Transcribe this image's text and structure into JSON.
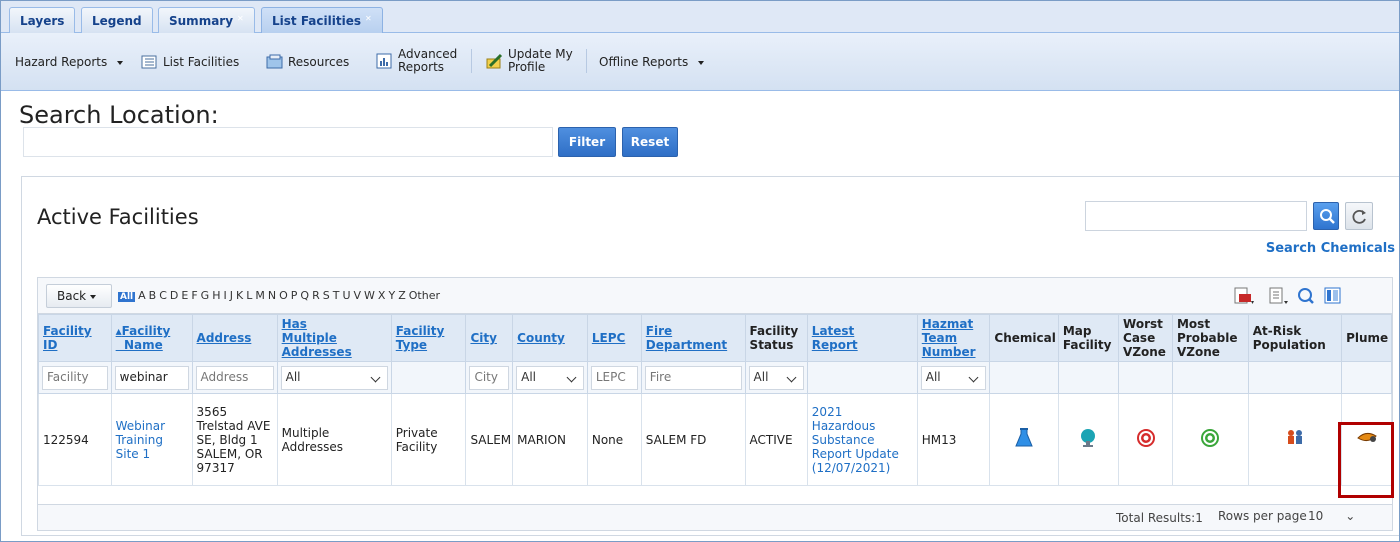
{
  "tabs": [
    {
      "label": "Layers",
      "closable": false
    },
    {
      "label": "Legend",
      "closable": false
    },
    {
      "label": "Summary",
      "closable": true
    },
    {
      "label": "List Facilities",
      "closable": true,
      "active": true
    }
  ],
  "toolbar": {
    "hazard_reports": "Hazard Reports",
    "list_facilities": "List Facilities",
    "resources": "Resources",
    "advanced_line1": "Advanced",
    "advanced_line2": "Reports",
    "update_line1": "Update My",
    "update_line2": "Profile",
    "offline_reports": "Offline Reports"
  },
  "search": {
    "title": "Search Location:",
    "value": "",
    "filter_label": "Filter",
    "reset_label": "Reset"
  },
  "active": {
    "title": "Active Facilities",
    "chem_value": "",
    "search_chemicals": "Search Chemicals"
  },
  "grid": {
    "back_label": "Back",
    "all_label": "All",
    "letters": [
      "A",
      "B",
      "C",
      "D",
      "E",
      "F",
      "G",
      "H",
      "I",
      "J",
      "K",
      "L",
      "M",
      "N",
      "O",
      "P",
      "Q",
      "R",
      "S",
      "T",
      "U",
      "V",
      "W",
      "X",
      "Y",
      "Z",
      "Other"
    ],
    "headers": {
      "facility_id_1": "Facility",
      "facility_id_2": "ID",
      "facility_name_1": "Facility",
      "facility_name_2": "Name",
      "address": "Address",
      "multi_1": "Has",
      "multi_2": "Multiple",
      "multi_3": "Addresses",
      "type_1": "Facility",
      "type_2": "Type",
      "city": "City",
      "county": "County",
      "lepc": "LEPC",
      "fire_1": "Fire",
      "fire_2": "Department",
      "status_1": "Facility",
      "status_2": "Status",
      "latest_1": "Latest",
      "latest_2": "Report",
      "hazmat_1": "Hazmat",
      "hazmat_2": "Team",
      "hazmat_3": "Number",
      "chemical": "Chemical",
      "map_1": "Map",
      "map_2": "Facility",
      "worst_1": "Worst",
      "worst_2": "Case",
      "worst_3": "VZone",
      "probable_1": "Most",
      "probable_2": "Probable",
      "probable_3": "VZone",
      "atrisk_1": "At-Risk",
      "atrisk_2": "Population",
      "plume": "Plume"
    },
    "filters": {
      "facility_ph": "Facility",
      "name_value": "webinar",
      "address_ph": "Address",
      "multi_value": "All",
      "city_ph": "City",
      "county_value": "All",
      "lepc_ph": "LEPC",
      "fire_ph": "Fire",
      "status_value": "All",
      "hazmat_value": "All"
    },
    "rows": [
      {
        "facility_id": "122594",
        "name_1": "Webinar",
        "name_2": "Training",
        "name_3": "Site 1",
        "addr_1": "3565",
        "addr_2": "Trelstad AVE",
        "addr_3": "SE, Bldg 1",
        "addr_4": "SALEM, OR",
        "addr_5": "97317",
        "multi_1": "Multiple",
        "multi_2": "Addresses",
        "type_1": "Private",
        "type_2": "Facility",
        "city": "SALEM",
        "county": "MARION",
        "lepc": "None",
        "fire": "SALEM FD",
        "status": "ACTIVE",
        "report_1": "2021",
        "report_2": "Hazardous",
        "report_3": "Substance",
        "report_4": "Report Update",
        "report_5": "(12/07/2021)",
        "hazmat": "HM13"
      }
    ],
    "footer": {
      "total": "Total Results:1",
      "rows_per_page_label": "Rows per page",
      "rows_per_page_value": "10"
    }
  },
  "colors": {
    "link": "#1f6fc5",
    "highlight": "#b00000",
    "button": "#2f6fc6"
  }
}
